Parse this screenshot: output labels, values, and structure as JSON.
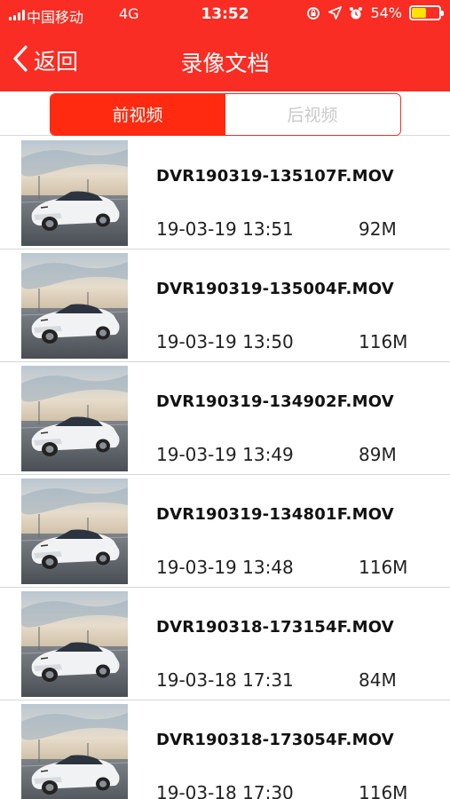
{
  "status_bar": {
    "carrier": "中国移动",
    "network": "4G",
    "time": "13:52",
    "battery_percent": "54%",
    "battery_level": 0.54,
    "battery_color": "#ffe400"
  },
  "nav": {
    "back_label": "返回",
    "title": "录像文档"
  },
  "tabs": [
    {
      "label": "前视频",
      "active": true
    },
    {
      "label": "后视频",
      "active": false
    }
  ],
  "colors": {
    "header_red": "#f92d23",
    "tab_active": "#ff2a0f"
  },
  "videos": [
    {
      "filename": "DVR190319-135107F.MOV",
      "datetime": "19-03-19 13:51",
      "size": "92M"
    },
    {
      "filename": "DVR190319-135004F.MOV",
      "datetime": "19-03-19 13:50",
      "size": "116M"
    },
    {
      "filename": "DVR190319-134902F.MOV",
      "datetime": "19-03-19 13:49",
      "size": "89M"
    },
    {
      "filename": "DVR190319-134801F.MOV",
      "datetime": "19-03-19 13:48",
      "size": "116M"
    },
    {
      "filename": "DVR190318-173154F.MOV",
      "datetime": "19-03-18 17:31",
      "size": "84M"
    },
    {
      "filename": "DVR190318-173054F.MOV",
      "datetime": "19-03-18 17:30",
      "size": "116M"
    }
  ],
  "icons": {
    "signal": "signal-bars-icon",
    "lock_rotation": "rotation-lock-icon",
    "location": "location-arrow-icon",
    "alarm": "alarm-clock-icon",
    "battery": "battery-icon",
    "back": "chevron-left-icon",
    "thumbnail": "car-thumbnail"
  }
}
